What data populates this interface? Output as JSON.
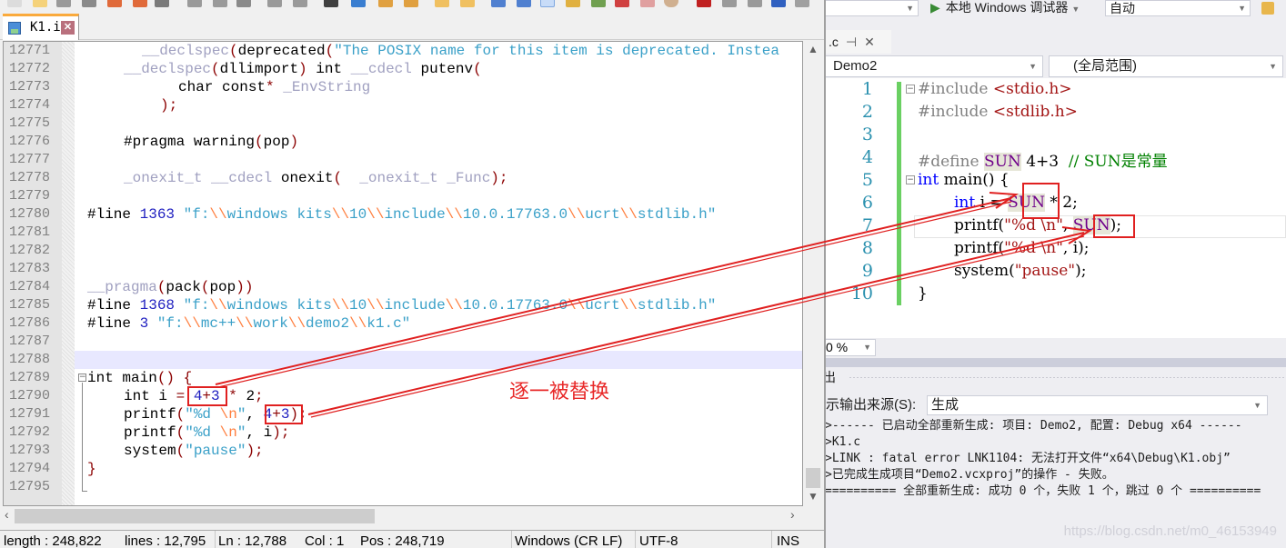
{
  "notepad": {
    "tab": {
      "label": "K1.i",
      "close_icon": "close-icon",
      "save_icon": "floppy-icon"
    },
    "lines": [
      {
        "num": "12771",
        "text": "__declspec(deprecated(\"The POSIX name for this item is deprecated. Instea"
      },
      {
        "num": "12772",
        "text": "__declspec(dllimport) int __cdecl putenv("
      },
      {
        "num": "12773",
        "text": "char const* _EnvString"
      },
      {
        "num": "12774",
        "text": ");"
      },
      {
        "num": "12775",
        "text": ""
      },
      {
        "num": "12776",
        "text": "#pragma warning(pop)"
      },
      {
        "num": "12777",
        "text": ""
      },
      {
        "num": "12778",
        "text": "_onexit_t __cdecl onexit(  _onexit_t _Func);"
      },
      {
        "num": "12779",
        "text": ""
      },
      {
        "num": "12780",
        "text": "#line 1363 \"f:\\\\windows kits\\\\10\\\\include\\\\10.0.17763.0\\\\ucrt\\\\stdlib.h\""
      },
      {
        "num": "12781",
        "text": ""
      },
      {
        "num": "12782",
        "text": ""
      },
      {
        "num": "12783",
        "text": ""
      },
      {
        "num": "12784",
        "text": "__pragma(pack(pop))"
      },
      {
        "num": "12785",
        "text": "#line 1368 \"f:\\\\windows kits\\\\10\\\\include\\\\10.0.17763.0\\\\ucrt\\\\stdlib.h\""
      },
      {
        "num": "12786",
        "text": "#line 3 \"f:\\\\mc++\\\\work\\\\demo2\\\\k1.c\""
      },
      {
        "num": "12787",
        "text": ""
      },
      {
        "num": "12788",
        "text": ""
      },
      {
        "num": "12789",
        "text": "int main() {"
      },
      {
        "num": "12790",
        "text": "int i = 4+3 * 2;"
      },
      {
        "num": "12791",
        "text": "printf(\"%d \\n\", 4+3);"
      },
      {
        "num": "12792",
        "text": "printf(\"%d \\n\", i);"
      },
      {
        "num": "12793",
        "text": "system(\"pause\");"
      },
      {
        "num": "12794",
        "text": "}"
      },
      {
        "num": "12795",
        "text": ""
      }
    ],
    "tokens": {
      "l12771": {
        "a": "__",
        "b": "declspec",
        "c": "(",
        "d": "deprecated",
        "e": "(",
        "f": "\"The POSIX name for this item is deprecated. Instea"
      },
      "l12772": {
        "a": "__",
        "b": "declspec",
        "c": "(",
        "d": "dllimport",
        "e": ")",
        "f": " int ",
        "g": "__cdecl",
        "h": " putenv",
        "i": "("
      },
      "l12773": {
        "a": "char const",
        "b": "*",
        "c": " _EnvString"
      },
      "l12774": {
        "a": ");"
      },
      "l12776": {
        "a": "#pragma warning",
        "b": "(",
        "c": "pop",
        "d": ")"
      },
      "l12778": {
        "a": "_onexit_t __cdecl",
        "b": " onexit",
        "c": "(",
        "d": "  _onexit_t _Func",
        "e": ");"
      },
      "l12780": {
        "a": "#line ",
        "b": "1363",
        "c": " \"f:",
        "d": "\\\\",
        "e": "windows kits",
        "f": "\\\\",
        "g": "10",
        "h": "\\\\",
        "i": "include",
        "j": "\\\\",
        "k": "10.0.17763.0",
        "l": "\\\\",
        "m": "ucrt",
        "n": "\\\\",
        "o": "stdlib.h\""
      },
      "l12784": {
        "a": "__pragma",
        "b": "(",
        "c": "pack",
        "d": "(",
        "e": "pop",
        "f": "))"
      },
      "l12785": {
        "a": "#line ",
        "b": "1368",
        "c": " \"f:",
        "d": "\\\\",
        "e": "windows kits",
        "f": "\\\\",
        "g": "10",
        "h": "\\\\",
        "i": "include",
        "j": "\\\\",
        "k": "10.0.17763.0",
        "l": "\\\\",
        "m": "ucrt",
        "n": "\\\\",
        "o": "stdlib.h\""
      },
      "l12786": {
        "a": "#line ",
        "b": "3",
        "c": " \"f:",
        "d": "\\\\",
        "e": "mc++",
        "f": "\\\\",
        "g": "work",
        "h": "\\\\",
        "i": "demo2",
        "j": "\\\\",
        "k": "k1.c\""
      },
      "l12789": {
        "a": "int main",
        "b": "()",
        "c": " {"
      },
      "l12790": {
        "a": "int i ",
        "b": "=",
        "c": " 4",
        "d": "+",
        "e": "3",
        "f": " *",
        "g": " 2",
        "h": ";"
      },
      "l12791": {
        "a": "printf",
        "b": "(",
        "c": "\"%d ",
        "d": "\\n",
        "e": "\"",
        "f": ", ",
        "g": "4",
        "h": "+",
        "i": "3",
        "j": ")",
        "k": ";"
      },
      "l12792": {
        "a": "printf",
        "b": "(",
        "c": "\"%d ",
        "d": "\\n",
        "e": "\"",
        "f": ", i",
        "g": ");"
      },
      "l12793": {
        "a": "system",
        "b": "(",
        "c": "\"pause\"",
        "d": ");"
      },
      "l12794": {
        "a": "}"
      }
    },
    "status": {
      "length": "length : 248,822",
      "lines": "lines : 12,795",
      "ln": "Ln : 12,788",
      "col": "Col : 1",
      "pos": "Pos : 248,719",
      "eol": "Windows (CR LF)",
      "encoding": "UTF-8",
      "mode": "INS"
    }
  },
  "annotation": {
    "text": "逐一被替换",
    "color": "#e82828"
  },
  "vs": {
    "toolbar": {
      "debugger": "本地 Windows 调试器",
      "arch": "自动"
    },
    "tab": {
      "label": ".c",
      "pin": "⊣",
      "close": "✕"
    },
    "nav": {
      "project": "Demo2",
      "scope": "(全局范围)"
    },
    "lines": [
      {
        "num": "1",
        "text": "#include <stdio.h>"
      },
      {
        "num": "2",
        "text": "#include <stdlib.h>"
      },
      {
        "num": "3",
        "text": ""
      },
      {
        "num": "4",
        "text": "#define SUN 4+3  // SUN是常量"
      },
      {
        "num": "5",
        "text": "int main() {"
      },
      {
        "num": "6",
        "text": "int i = SUN * 2;"
      },
      {
        "num": "7",
        "text": "printf(\"%d \\n\", SUN);"
      },
      {
        "num": "8",
        "text": "printf(\"%d \\n\", i);"
      },
      {
        "num": "9",
        "text": "system(\"pause\");"
      },
      {
        "num": "10",
        "text": "}"
      }
    ],
    "tokens": {
      "l1": {
        "a": "#include ",
        "b": "<stdio.h>"
      },
      "l2": {
        "a": "#include ",
        "b": "<stdlib.h>"
      },
      "l4": {
        "a": "#define ",
        "b": "SUN",
        "c": " 4+3  ",
        "d": "// SUN是常量"
      },
      "l5": {
        "a": "int",
        "b": " main() {"
      },
      "l6": {
        "a": "int",
        "b": " i = ",
        "c": "SUN",
        "d": " * 2;"
      },
      "l7": {
        "a": "printf(",
        "b": "\"%d \\n\"",
        "c": ", ",
        "d": "SUN",
        "e": ");"
      },
      "l8": {
        "a": "printf(",
        "b": "\"%d \\n\"",
        "c": ", i);"
      },
      "l9": {
        "a": "system(",
        "b": "\"pause\"",
        "c": ");"
      },
      "l10": {
        "a": "}"
      }
    },
    "zoom": "0 %",
    "output": {
      "title": "出",
      "source_label": "显示输出来源(S):",
      "source_value": "生成",
      "lines": [
        ">------ 已启动全部重新生成: 项目: Demo2, 配置: Debug x64 ------",
        ">K1.c",
        ">LINK : fatal error LNK1104: 无法打开文件“x64\\Debug\\K1.obj”",
        ">已完成生成项目“Demo2.vcxproj”的操作 - 失败。",
        "========== 全部重新生成: 成功 0 个，失败 1 个，跳过 0 个 =========="
      ]
    },
    "watermark": "https://blog.csdn.net/m0_46153949"
  }
}
